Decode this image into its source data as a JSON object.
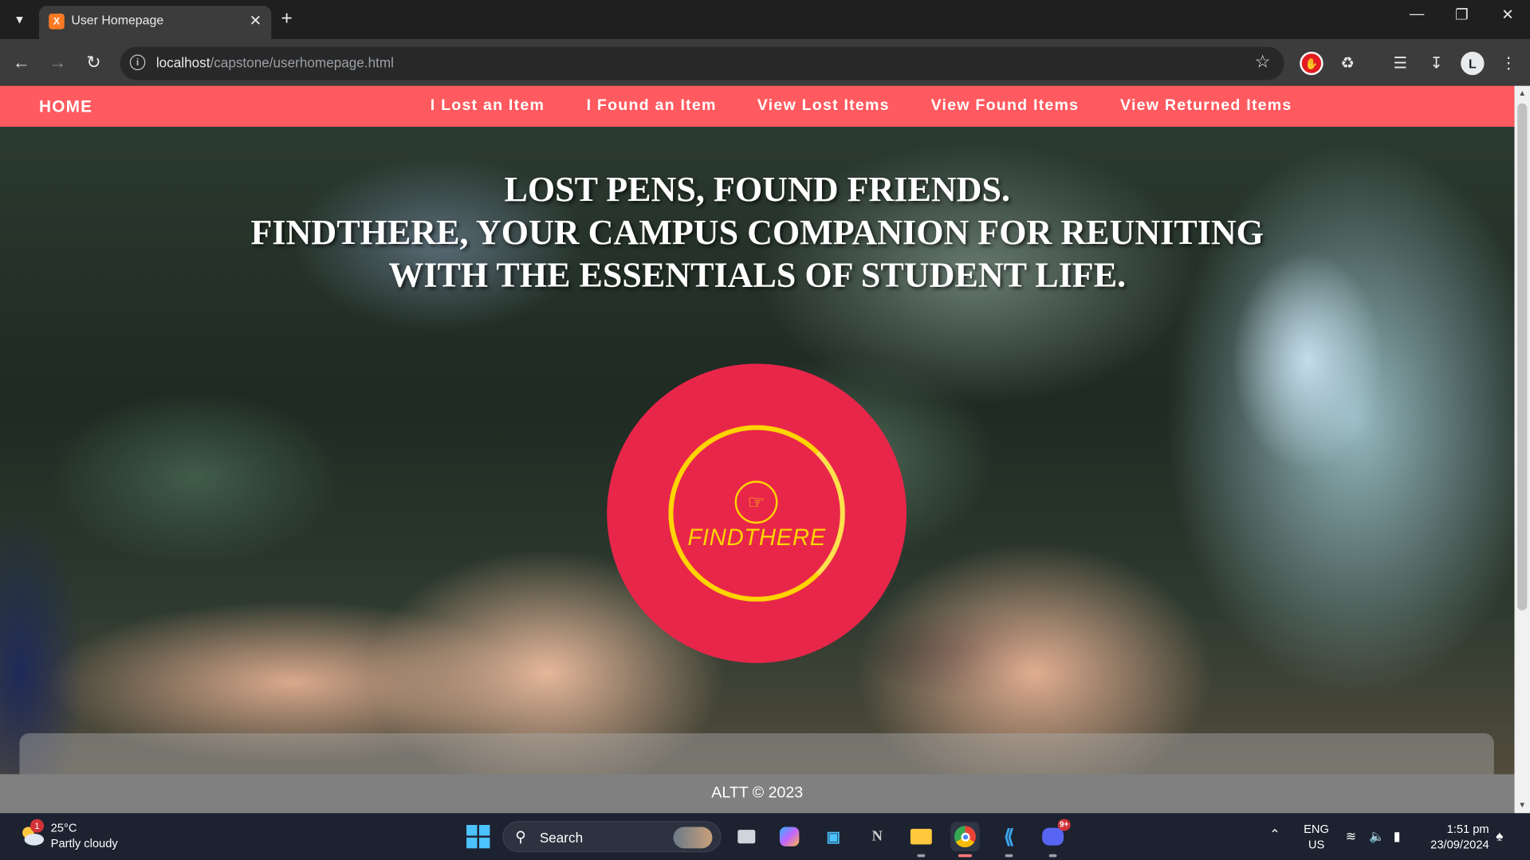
{
  "browser": {
    "tab_title": "User Homepage",
    "url_host": "localhost",
    "url_path": "/capstone/userhomepage.html",
    "favicon_letter": "X"
  },
  "nav": {
    "home": "HOME",
    "links": [
      "I Lost an Item",
      "I Found an Item",
      "View Lost Items",
      "View Found Items",
      "View Returned Items"
    ]
  },
  "hero": {
    "line1": "LOST PENS, FOUND FRIENDS.",
    "line2": "FINDTHERE, YOUR CAMPUS COMPANION FOR REUNITING",
    "line3": "WITH THE ESSENTIALS OF STUDENT LIFE."
  },
  "logo": {
    "text": "FINDTHERE"
  },
  "footer": {
    "text": "ALTT © 2023"
  },
  "taskbar": {
    "weather_temp": "25°C",
    "weather_desc": "Partly cloudy",
    "weather_badge": "1",
    "search_label": "Search",
    "lang_top": "ENG",
    "lang_bottom": "US",
    "time": "1:51 pm",
    "date": "23/09/2024",
    "discord_badge": "9+"
  },
  "colors": {
    "nav_bg": "#ff5a5f",
    "logo_circle": "#e8264a",
    "logo_accent": "#ffd400",
    "footer_bg": "#808080"
  }
}
